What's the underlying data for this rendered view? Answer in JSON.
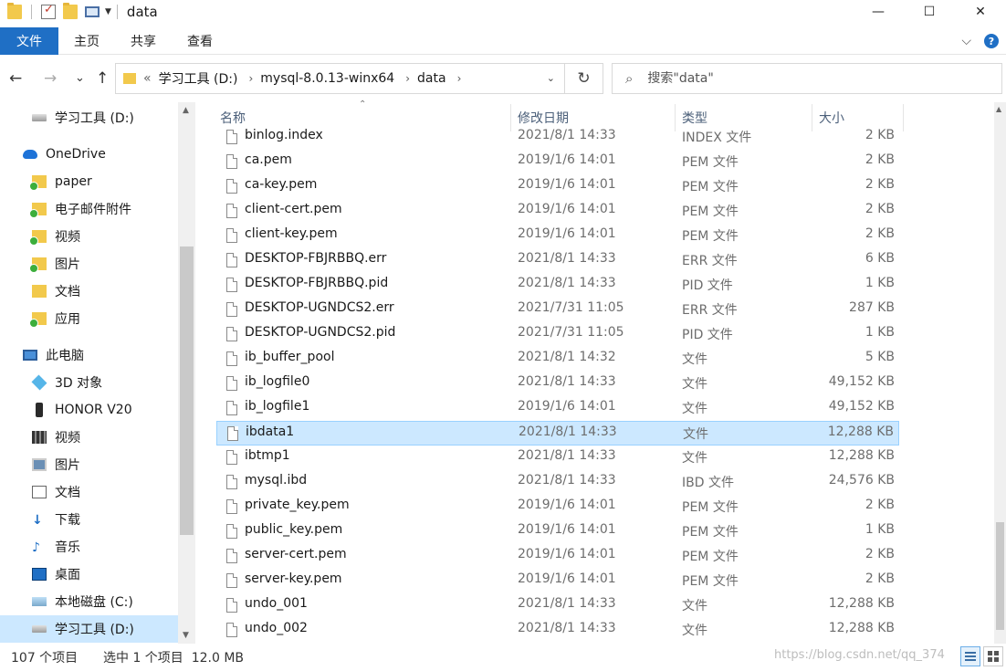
{
  "window": {
    "title": "data",
    "controls": {
      "minimize": "—",
      "maximize": "☐",
      "close": "✕"
    }
  },
  "ribbon": {
    "tabs": [
      "文件",
      "主页",
      "共享",
      "查看"
    ],
    "expand": "⌵",
    "help": "?"
  },
  "nav": {
    "back": "←",
    "forward": "→",
    "recent": "⌄",
    "up": "↑"
  },
  "address": {
    "overflow": "«",
    "crumbs": [
      "学习工具 (D:)",
      "mysql-8.0.13-winx64",
      "data"
    ],
    "separator": "›",
    "dropdown": "⌄",
    "refresh": "↻"
  },
  "search": {
    "icon": "⌕",
    "placeholder": "搜索\"data\""
  },
  "navpane": {
    "items": [
      {
        "label": "学习工具 (D:)",
        "icon": "drive-icon",
        "indent": 1
      },
      {
        "label": "OneDrive",
        "icon": "cloud-icon",
        "indent": 0
      },
      {
        "label": "paper",
        "icon": "folder-icon",
        "indent": 1
      },
      {
        "label": "电子邮件附件",
        "icon": "folder-icon",
        "indent": 1
      },
      {
        "label": "视频",
        "icon": "folder-icon",
        "indent": 1
      },
      {
        "label": "图片",
        "icon": "folder-icon",
        "indent": 1
      },
      {
        "label": "文档",
        "icon": "folder-icon",
        "indent": 1
      },
      {
        "label": "应用",
        "icon": "folder-icon",
        "indent": 1
      },
      {
        "label": "此电脑",
        "icon": "computer-icon",
        "indent": 0
      },
      {
        "label": "3D 对象",
        "icon": "3d-objects-icon",
        "indent": 1
      },
      {
        "label": "HONOR V20",
        "icon": "phone-icon",
        "indent": 1
      },
      {
        "label": "视频",
        "icon": "video-icon",
        "indent": 1
      },
      {
        "label": "图片",
        "icon": "picture-icon",
        "indent": 1
      },
      {
        "label": "文档",
        "icon": "document-icon",
        "indent": 1
      },
      {
        "label": "下载",
        "icon": "download-icon",
        "indent": 1
      },
      {
        "label": "音乐",
        "icon": "music-icon",
        "indent": 1
      },
      {
        "label": "桌面",
        "icon": "desktop-icon",
        "indent": 1
      },
      {
        "label": "本地磁盘 (C:)",
        "icon": "system-drive-icon",
        "indent": 1
      },
      {
        "label": "学习工具 (D:)",
        "icon": "drive-icon",
        "indent": 1,
        "selected": true
      }
    ]
  },
  "columns": {
    "name": "名称",
    "date": "修改日期",
    "type": "类型",
    "size": "大小"
  },
  "files": [
    {
      "name": "binlog.index",
      "date": "2021/8/1 14:33",
      "type": "INDEX 文件",
      "size": "2 KB"
    },
    {
      "name": "ca.pem",
      "date": "2019/1/6 14:01",
      "type": "PEM 文件",
      "size": "2 KB"
    },
    {
      "name": "ca-key.pem",
      "date": "2019/1/6 14:01",
      "type": "PEM 文件",
      "size": "2 KB"
    },
    {
      "name": "client-cert.pem",
      "date": "2019/1/6 14:01",
      "type": "PEM 文件",
      "size": "2 KB"
    },
    {
      "name": "client-key.pem",
      "date": "2019/1/6 14:01",
      "type": "PEM 文件",
      "size": "2 KB"
    },
    {
      "name": "DESKTOP-FBJRBBQ.err",
      "date": "2021/8/1 14:33",
      "type": "ERR 文件",
      "size": "6 KB"
    },
    {
      "name": "DESKTOP-FBJRBBQ.pid",
      "date": "2021/8/1 14:33",
      "type": "PID 文件",
      "size": "1 KB"
    },
    {
      "name": "DESKTOP-UGNDCS2.err",
      "date": "2021/7/31 11:05",
      "type": "ERR 文件",
      "size": "287 KB"
    },
    {
      "name": "DESKTOP-UGNDCS2.pid",
      "date": "2021/7/31 11:05",
      "type": "PID 文件",
      "size": "1 KB"
    },
    {
      "name": "ib_buffer_pool",
      "date": "2021/8/1 14:32",
      "type": "文件",
      "size": "5 KB"
    },
    {
      "name": "ib_logfile0",
      "date": "2021/8/1 14:33",
      "type": "文件",
      "size": "49,152 KB"
    },
    {
      "name": "ib_logfile1",
      "date": "2019/1/6 14:01",
      "type": "文件",
      "size": "49,152 KB"
    },
    {
      "name": "ibdata1",
      "date": "2021/8/1 14:33",
      "type": "文件",
      "size": "12,288 KB",
      "selected": true
    },
    {
      "name": "ibtmp1",
      "date": "2021/8/1 14:33",
      "type": "文件",
      "size": "12,288 KB"
    },
    {
      "name": "mysql.ibd",
      "date": "2021/8/1 14:33",
      "type": "IBD 文件",
      "size": "24,576 KB"
    },
    {
      "name": "private_key.pem",
      "date": "2019/1/6 14:01",
      "type": "PEM 文件",
      "size": "2 KB"
    },
    {
      "name": "public_key.pem",
      "date": "2019/1/6 14:01",
      "type": "PEM 文件",
      "size": "1 KB"
    },
    {
      "name": "server-cert.pem",
      "date": "2019/1/6 14:01",
      "type": "PEM 文件",
      "size": "2 KB"
    },
    {
      "name": "server-key.pem",
      "date": "2019/1/6 14:01",
      "type": "PEM 文件",
      "size": "2 KB"
    },
    {
      "name": "undo_001",
      "date": "2021/8/1 14:33",
      "type": "文件",
      "size": "12,288 KB"
    },
    {
      "name": "undo_002",
      "date": "2021/8/1 14:33",
      "type": "文件",
      "size": "12,288 KB"
    }
  ],
  "status": {
    "count": "107 个项目",
    "selection": "选中 1 个项目  12.0 MB",
    "watermark": "https://blog.csdn.net/qq_374"
  },
  "colors": {
    "accent": "#1f6fc5",
    "selection": "#cce8ff",
    "selection_border": "#99d1ff",
    "header_text": "#4c607a"
  }
}
